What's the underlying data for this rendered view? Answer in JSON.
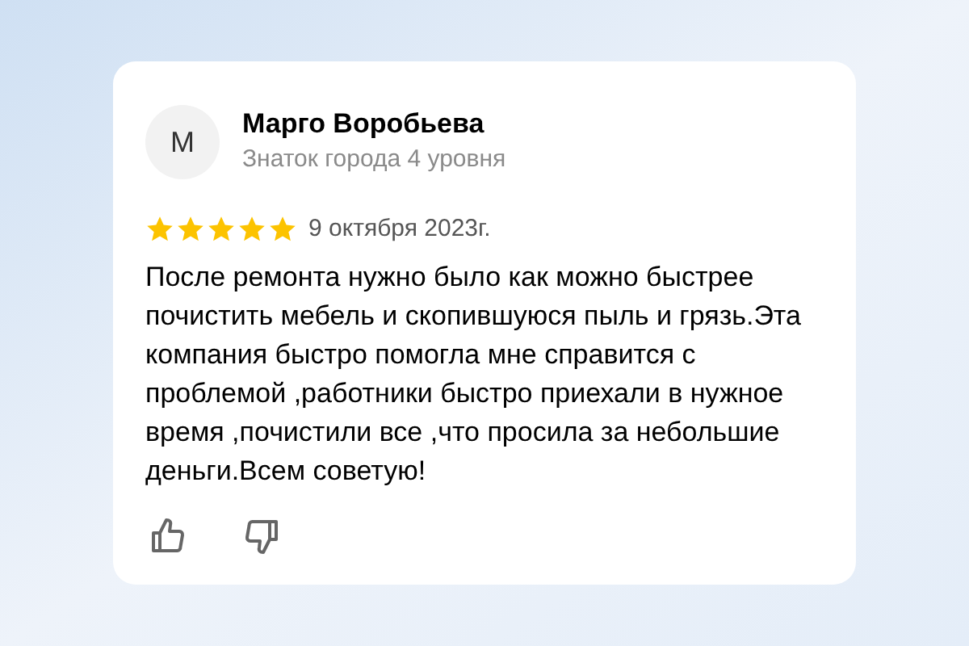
{
  "review": {
    "avatar_letter": "М",
    "author": "Марго Воробьева",
    "author_level": "Знаток города 4 уровня",
    "stars": 5,
    "date": "9 октября 2023г.",
    "text": "После ремонта нужно было как можно быстрее почистить мебель и скопившуюся пыль и грязь.Эта компания быстро помогла мне справится с проблемой ,работники быстро приехали в нужное время ,почистили все ,что просила за небольшие деньги.Всем советую!"
  }
}
